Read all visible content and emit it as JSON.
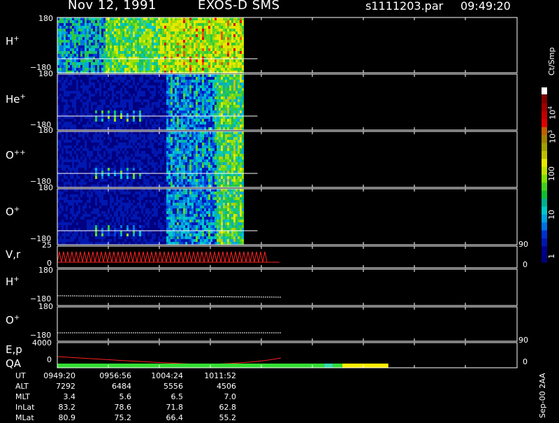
{
  "header": {
    "date": "Nov 12, 1991",
    "mission": "EXOS-D SMS",
    "file": "s1111203.par",
    "time": "09:49:20"
  },
  "colorbar": {
    "unit": "Ct/Smp",
    "labels": {
      "e4": "10",
      "e4_exp": "4",
      "e3": "10",
      "e3_exp": "3",
      "l100": "100",
      "l10": "10",
      "l1": "1"
    },
    "colors": [
      "#000080",
      "#00008c",
      "#0018b0",
      "#0030d0",
      "#0070e0",
      "#00a0e0",
      "#00c8c8",
      "#00b090",
      "#10c030",
      "#40d020",
      "#80e000",
      "#c0e000",
      "#e8e800",
      "#c0c000",
      "#a0a000",
      "#a08000",
      "#c06000",
      "#e00000",
      "#c00000",
      "#a00000",
      "#800000",
      "#600000"
    ]
  },
  "chart_data": [
    {
      "type": "heatmap",
      "panel": "H+",
      "label": "H",
      "sup": "+",
      "ylim": [
        -180,
        180
      ],
      "ticks": {
        "top": "180",
        "bottom": "−180"
      },
      "fill_fraction": 0.405,
      "dominant": "green-yellow-red"
    },
    {
      "type": "heatmap",
      "panel": "He+",
      "label": "He",
      "sup": "+",
      "ylim": [
        -180,
        180
      ],
      "ticks": {
        "top": "180",
        "bottom": "−180"
      },
      "fill_fraction": 0.405,
      "dominant": "blue-green"
    },
    {
      "type": "heatmap",
      "panel": "O++",
      "label": "O",
      "sup": "++",
      "ylim": [
        -180,
        180
      ],
      "ticks": {
        "top": "180",
        "bottom": "−180"
      },
      "fill_fraction": 0.405,
      "dominant": "blue-green"
    },
    {
      "type": "heatmap",
      "panel": "O+",
      "label": "O",
      "sup": "+",
      "ylim": [
        -180,
        180
      ],
      "ticks": {
        "top": "180",
        "bottom": "−180"
      },
      "fill_fraction": 0.405,
      "dominant": "blue-green"
    },
    {
      "type": "line",
      "panel": "V,r",
      "label": "V,r",
      "ylim": [
        0,
        25
      ],
      "ticks": {
        "top": "25",
        "bottom": "0"
      },
      "right_ticks": {
        "top": "90",
        "bottom": "0"
      }
    },
    {
      "type": "line",
      "panel": "H+ (2)",
      "label": "H",
      "sup": "+",
      "ylim": [
        -180,
        180
      ],
      "ticks": {
        "top": "180",
        "bottom": "−180"
      }
    },
    {
      "type": "line",
      "panel": "O+ (2)",
      "label": "O",
      "sup": "+",
      "ylim": [
        -180,
        180
      ],
      "ticks": {
        "top": "180",
        "bottom": "−180"
      }
    },
    {
      "type": "line",
      "panel": "E,p",
      "label": "E,p",
      "ylim": [
        0,
        4000
      ],
      "ticks": {
        "top": "4000",
        "bottom": "0"
      },
      "right_ticks": {
        "top": "90",
        "bottom": "0"
      }
    },
    {
      "type": "bar",
      "panel": "QA",
      "label": "QA",
      "segments": [
        {
          "from": 0,
          "to": 0.58,
          "color": "#33dd33"
        },
        {
          "from": 0.58,
          "to": 0.6,
          "color": "#33ddaa"
        },
        {
          "from": 0.6,
          "to": 0.62,
          "color": "#33dd33"
        },
        {
          "from": 0.62,
          "to": 0.72,
          "color": "#ffee00"
        }
      ]
    }
  ],
  "footer": {
    "rows": [
      {
        "label": "UT",
        "values": [
          "0949:20",
          "0956:56",
          "1004:24",
          "1011:52"
        ]
      },
      {
        "label": "ALT",
        "values": [
          "7292",
          "6484",
          "5556",
          "4506"
        ]
      },
      {
        "label": "MLT",
        "values": [
          "3.4",
          "5.6",
          "6.5",
          "7.0"
        ]
      },
      {
        "label": "InLat",
        "values": [
          "83.2",
          "78.6",
          "71.8",
          "62.8"
        ]
      },
      {
        "label": "MLat",
        "values": [
          "80.9",
          "75.2",
          "66.4",
          "55.2"
        ]
      }
    ],
    "stamp": "Sep-00 2AA"
  }
}
